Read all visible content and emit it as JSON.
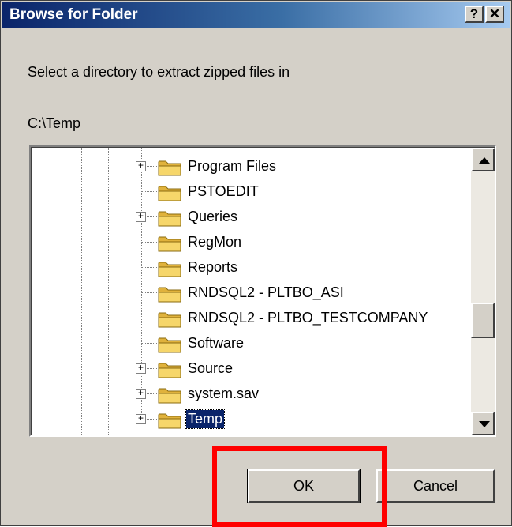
{
  "window": {
    "title": "Browse for Folder",
    "help_button": "?",
    "close_button": "✕"
  },
  "prompt": "Select a directory to extract zipped files in",
  "selected_path": "C:\\Temp",
  "tree": {
    "items": [
      {
        "label": "Program Files",
        "expandable": true,
        "selected": false
      },
      {
        "label": "PSTOEDIT",
        "expandable": false,
        "selected": false
      },
      {
        "label": "Queries",
        "expandable": true,
        "selected": false
      },
      {
        "label": "RegMon",
        "expandable": false,
        "selected": false
      },
      {
        "label": "Reports",
        "expandable": false,
        "selected": false
      },
      {
        "label": "RNDSQL2 - PLTBO_ASI",
        "expandable": false,
        "selected": false
      },
      {
        "label": "RNDSQL2 - PLTBO_TESTCOMPANY",
        "expandable": false,
        "selected": false
      },
      {
        "label": "Software",
        "expandable": false,
        "selected": false
      },
      {
        "label": "Source",
        "expandable": true,
        "selected": false
      },
      {
        "label": "system.sav",
        "expandable": true,
        "selected": false
      },
      {
        "label": "Temp",
        "expandable": true,
        "selected": true
      }
    ]
  },
  "buttons": {
    "ok": "OK",
    "cancel": "Cancel"
  },
  "colors": {
    "highlight_box": "#ff0000",
    "folder_fill": "#f6d66a",
    "selection": "#0a246a"
  }
}
